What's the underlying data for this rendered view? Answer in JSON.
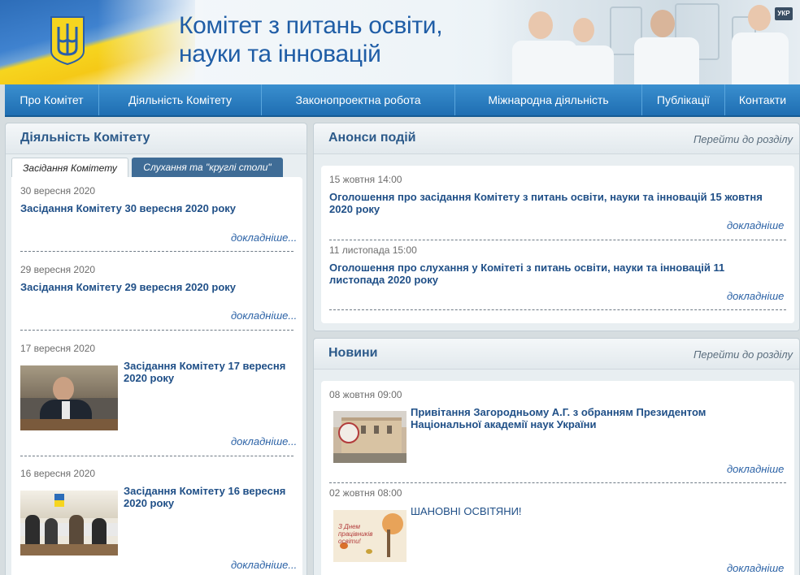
{
  "header": {
    "title_line1": "Комітет з питань освіти,",
    "title_line2": "науки та інновацій",
    "lang": "УКР",
    "emblem": "trident-emblem-icon",
    "flag_colors": [
      "#3f82cf",
      "#f6d51f"
    ]
  },
  "nav": {
    "items": [
      {
        "label": "Про Комітет"
      },
      {
        "label": "Діяльність Комітету"
      },
      {
        "label": "Законопроектна робота"
      },
      {
        "label": "Міжнародна діяльність"
      },
      {
        "label": "Публікації"
      },
      {
        "label": "Контакти"
      }
    ]
  },
  "activity": {
    "title": "Діяльність Комітету",
    "tabs": [
      {
        "label": "Засідання Комітету"
      },
      {
        "label": "Слухання та \"круглі столи\""
      }
    ],
    "items": [
      {
        "date": "30 вересня 2020",
        "title": "Засідання Комітету 30 вересня 2020 року",
        "more": "докладніше..."
      },
      {
        "date": "29 вересня 2020",
        "title": "Засідання Комітету 29 вересня 2020 року",
        "more": "докладніше..."
      },
      {
        "date": "17 вересня 2020",
        "title": "Засідання Комітету 17 вересня 2020 року",
        "more": "докладніше..."
      },
      {
        "date": "16 вересня 2020",
        "title": "Засідання Комітету 16 вересня 2020 року",
        "more": "докладніше..."
      }
    ]
  },
  "announcements": {
    "title": "Анонси подій",
    "goto": "Перейти до розділу",
    "items": [
      {
        "date": "15 жовтня 14:00",
        "title": "Оголошення про засідання Комітету з питань освіти, науки та інновацій 15 жовтня 2020 року",
        "more": "докладніше"
      },
      {
        "date": "11 листопада 15:00",
        "title": "Оголошення про слухання у Комітеті з питань освіти, науки та інновацій 11 листопада 2020 року",
        "more": "докладніше"
      }
    ]
  },
  "news": {
    "title": "Новини",
    "goto": "Перейти до розділу",
    "items": [
      {
        "date": "08 жовтня 09:00",
        "title": "Привітання Загородньому А.Г. з обранням Президентом Національної академії наук України",
        "more": "докладніше"
      },
      {
        "date": "02 жовтня 08:00",
        "title": "ШАНОВНІ ОСВІТЯНИ!",
        "more": "докладніше",
        "image_text": "З Днем працівників освіти!"
      }
    ]
  }
}
